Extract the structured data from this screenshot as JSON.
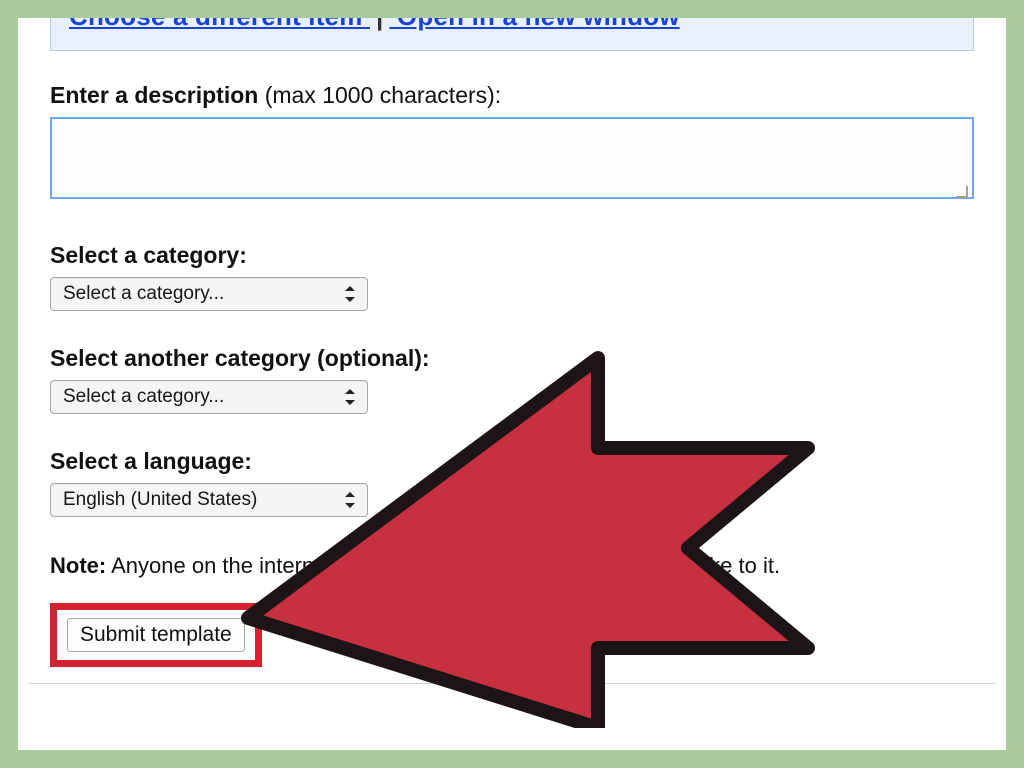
{
  "banner": {
    "link1": "Choose a different item",
    "sep": "|",
    "link2": "Open in a new window"
  },
  "description": {
    "label_bold": "Enter a description",
    "label_rest": " (max 1000 characters):",
    "value": ""
  },
  "category1": {
    "label": "Select a category:",
    "selected": "Select a category..."
  },
  "category2": {
    "label": "Select another category (optional):",
    "selected": "Select a category..."
  },
  "language": {
    "label": "Select a language:",
    "selected": "English (United States)"
  },
  "note": {
    "label": "Note:",
    "text_before": " Anyone on the internet wi",
    "text_gap": "",
    "text_after": "r template and any changes you make to it."
  },
  "submit": {
    "label": "Submit template"
  }
}
